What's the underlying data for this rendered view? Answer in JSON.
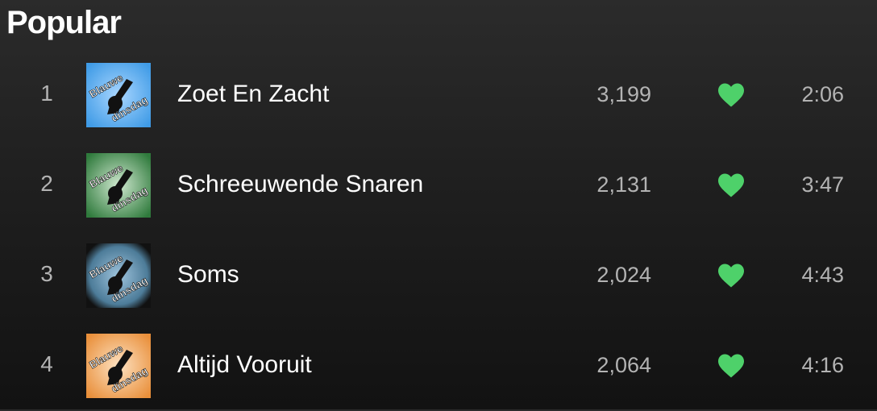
{
  "section": {
    "title": "Popular"
  },
  "colors": {
    "like": "#4ed16a",
    "muted_text": "#b3b3b3"
  },
  "tracks": [
    {
      "number": "1",
      "title": "Zoet En Zacht",
      "plays": "3,199",
      "duration": "2:06",
      "liked": true,
      "cover_color": "#3f9be6",
      "cover_icon": "band-logo-icon",
      "cover_text": [
        "Blauwe",
        "dinsdag"
      ]
    },
    {
      "number": "2",
      "title": "Schreeuwende Snaren",
      "plays": "2,131",
      "duration": "3:47",
      "liked": true,
      "cover_color": "#3f8a4a",
      "cover_icon": "band-logo-icon",
      "cover_text": [
        "Blauwe",
        "dinsdag"
      ]
    },
    {
      "number": "3",
      "title": "Soms",
      "plays": "2,024",
      "duration": "4:43",
      "liked": true,
      "cover_color": "#5e8aa8",
      "cover_icon": "band-logo-icon",
      "cover_text": [
        "Blauwe",
        "dinsdag"
      ]
    },
    {
      "number": "4",
      "title": "Altijd Vooruit",
      "plays": "2,064",
      "duration": "4:16",
      "liked": true,
      "cover_color": "#e98f3a",
      "cover_icon": "band-logo-icon",
      "cover_text": [
        "Blauwe",
        "dinsdag"
      ]
    }
  ]
}
